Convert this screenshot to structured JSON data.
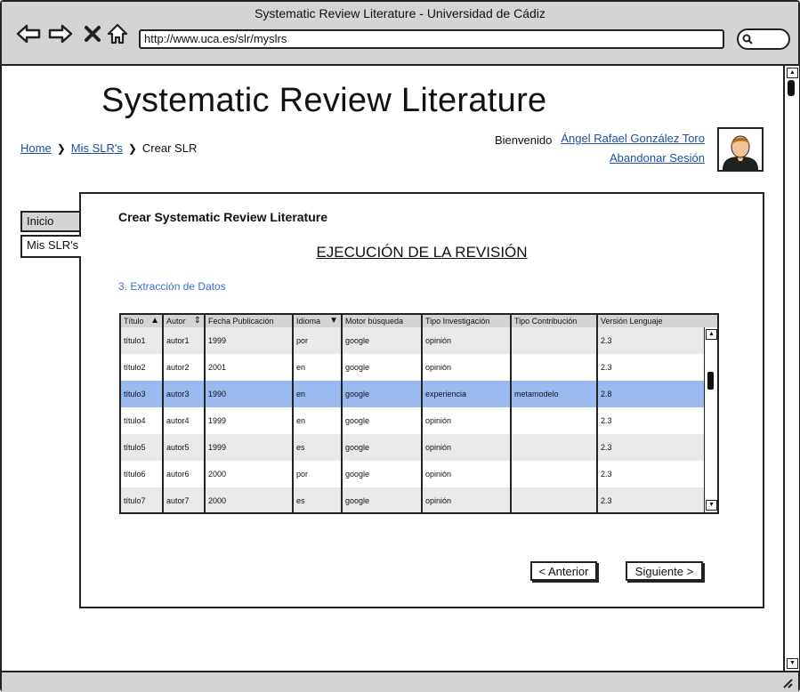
{
  "window": {
    "title": "Systematic Review Literature - Universidad de Cádiz"
  },
  "browser": {
    "url": "http://www.uca.es/slr/myslrs",
    "icons": [
      "back-arrow-icon",
      "forward-arrow-icon",
      "close-icon",
      "home-icon",
      "search-icon"
    ]
  },
  "header": {
    "title": "Systematic Review Literature",
    "breadcrumb": {
      "home": "Home",
      "myslrs": "Mis SLR's",
      "current": "Crear SLR"
    },
    "welcome": "Bienvenido",
    "user_name": "Ángel Rafael González Toro",
    "logout": "Abandonar Sesión"
  },
  "tabs": [
    {
      "label": "Inicio"
    },
    {
      "label": "Mis SLR's"
    }
  ],
  "main": {
    "heading": "Crear Systematic Review Literature",
    "section": "EJECUCIÓN DE LA REVISIÓN",
    "subsection": "3. Extracción de Datos",
    "columns": [
      "Título",
      "Autor",
      "Fecha Publicación",
      "Idioma",
      "Motor búsqueda",
      "Tipo Investigación",
      "Tipo Contribución",
      "Versión Lenguaje"
    ],
    "rows": [
      [
        "título1",
        "autor1",
        "1999",
        "por",
        "google",
        "opinión",
        "",
        "2.3"
      ],
      [
        "título2",
        "autor2",
        "2001",
        "en",
        "google",
        "opinión",
        "",
        "2.3"
      ],
      [
        "título3",
        "autor3",
        "1990",
        "en",
        "google",
        "experiencia",
        "metamodelo",
        "2.8"
      ],
      [
        "título4",
        "autor4",
        "1999",
        "en",
        "google",
        "opinión",
        "",
        "2.3"
      ],
      [
        "título5",
        "autor5",
        "1999",
        "es",
        "google",
        "opinión",
        "",
        "2.3"
      ],
      [
        "título6",
        "autor6",
        "2000",
        "por",
        "google",
        "opinión",
        "",
        "2.3"
      ],
      [
        "título7",
        "autor7",
        "2000",
        "es",
        "google",
        "opinión",
        "",
        "2.3"
      ]
    ],
    "selected_row": 2,
    "buttons": {
      "prev": "< Anterior",
      "next": "Siguiente >"
    }
  },
  "colors": {
    "selected_row": "#9ab9ee",
    "alt_row": "#e9e9e9",
    "chrome": "#d4d4d4",
    "link": "#1f4fa3",
    "subsection": "#3a6fd6"
  }
}
